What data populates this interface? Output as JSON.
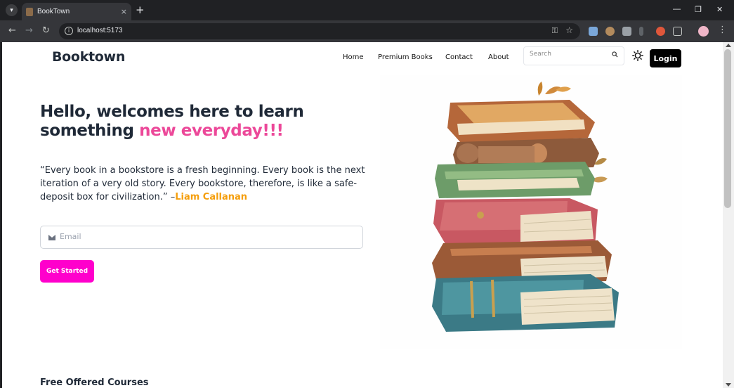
{
  "browser": {
    "tab_title": "BookTown",
    "url": "localhost:5173",
    "new_tab": "+",
    "close_tab": "×"
  },
  "header": {
    "brand": "Booktown",
    "nav": [
      "Home",
      "Premium Books",
      "Contact",
      "About"
    ],
    "search_placeholder": "Search",
    "login_label": "Login"
  },
  "hero": {
    "heading_main": "Hello, welcomes here to learn something ",
    "heading_highlight": "new everyday!!!",
    "quote": "“Every book in a bookstore is a fresh beginning. Every book is the next iteration of a very old story. Every bookstore, therefore, is like a safe-deposit box for civilization.” –",
    "quote_author": "Liam Callanan",
    "email_placeholder": "Email",
    "cta_label": "Get Started"
  },
  "courses": {
    "title": "Free Offered Courses"
  },
  "colors": {
    "accent_pink": "#ec4899",
    "cta_magenta": "#ff00cc",
    "author_orange": "#f59e0b",
    "heading_dark": "#1f2937"
  }
}
